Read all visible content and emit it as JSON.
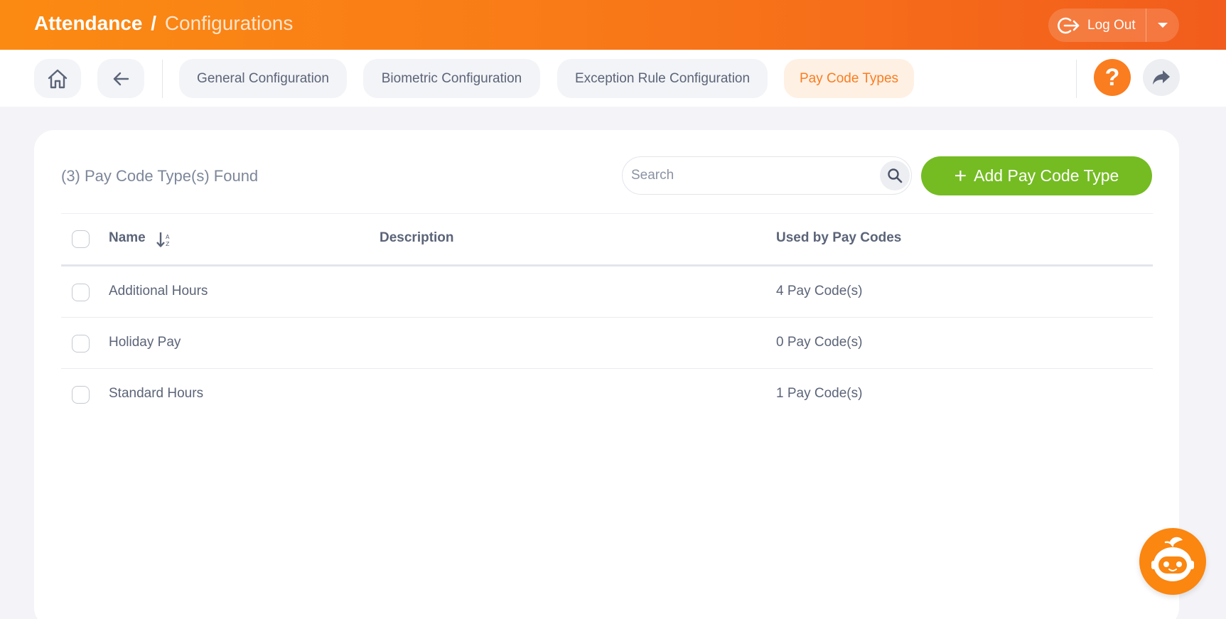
{
  "header": {
    "title_main": "Attendance",
    "title_separator": "/",
    "title_sub": "Configurations",
    "logout_label": "Log Out"
  },
  "nav": {
    "tabs": [
      {
        "label": "General Configuration",
        "active": false
      },
      {
        "label": "Biometric Configuration",
        "active": false
      },
      {
        "label": "Exception Rule Configuration",
        "active": false
      },
      {
        "label": "Pay Code Types",
        "active": true
      }
    ],
    "help_label": "?"
  },
  "main": {
    "found_text": "(3) Pay Code Type(s) Found",
    "search": {
      "placeholder": "Search",
      "value": ""
    },
    "add_button_label": "Add Pay Code Type",
    "table": {
      "columns": [
        "Name",
        "Description",
        "Used by Pay Codes"
      ],
      "rows": [
        {
          "name": "Additional Hours",
          "description": "",
          "used_by": "4 Pay Code(s)"
        },
        {
          "name": "Holiday Pay",
          "description": "",
          "used_by": "0 Pay Code(s)"
        },
        {
          "name": "Standard Hours",
          "description": "",
          "used_by": "1 Pay Code(s)"
        }
      ]
    }
  },
  "icons": [
    "logout-icon",
    "chevron-down-icon",
    "home-icon",
    "back-arrow-icon",
    "help-icon",
    "share-icon",
    "search-icon",
    "plus-icon",
    "sort-az-icon",
    "chatbot-icon"
  ],
  "colors": {
    "header_gradient_start": "#fb8a12",
    "header_gradient_end": "#f25c1c",
    "accent_orange": "#fa7d1f",
    "active_tab_bg": "#fff0e4",
    "add_button_green": "#74bc22",
    "text": "#5b6478"
  }
}
